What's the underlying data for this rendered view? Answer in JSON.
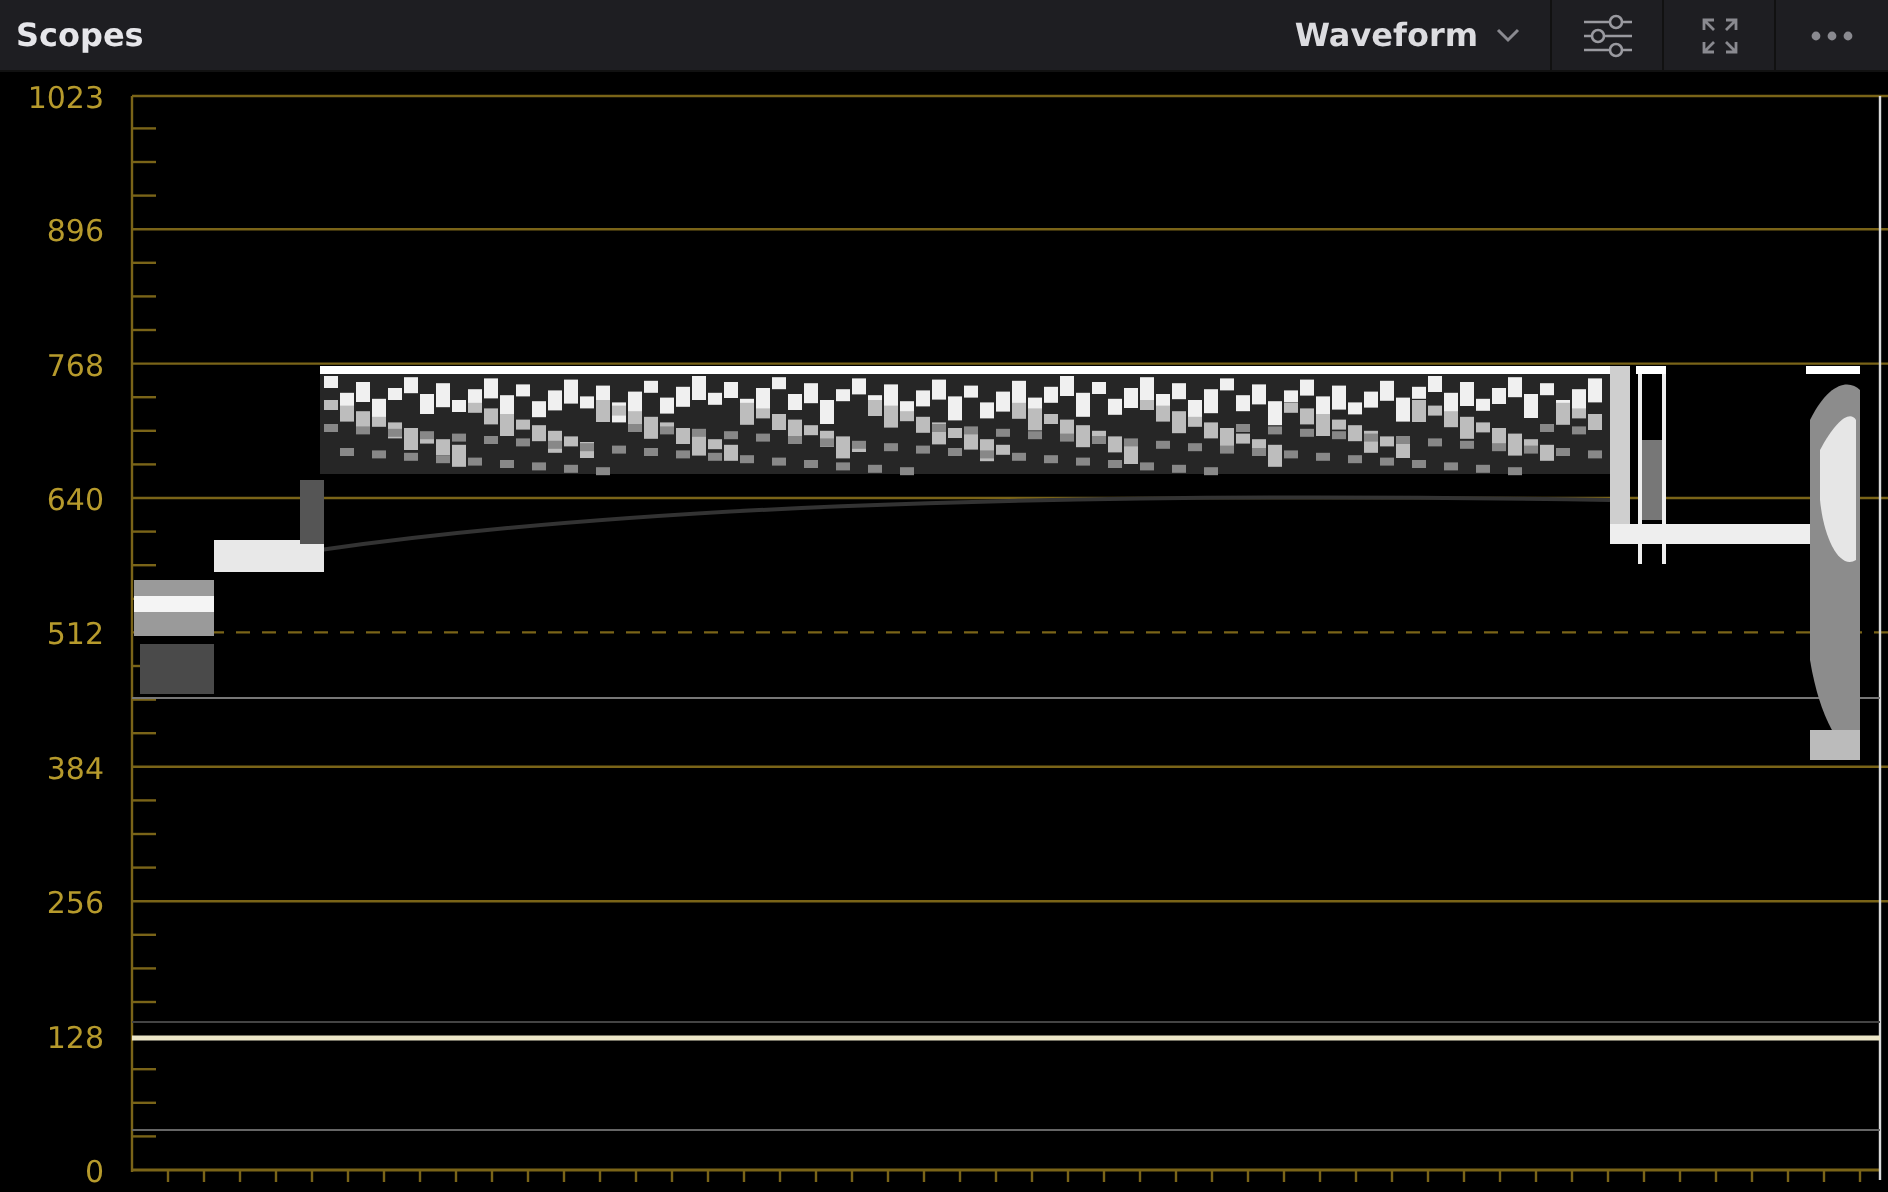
{
  "panel": {
    "title": "Scopes"
  },
  "scope_type": {
    "label": "Waveform"
  },
  "y_axis": {
    "labels": [
      "1023",
      "896",
      "768",
      "640",
      "512",
      "384",
      "256",
      "128",
      "0"
    ]
  }
}
